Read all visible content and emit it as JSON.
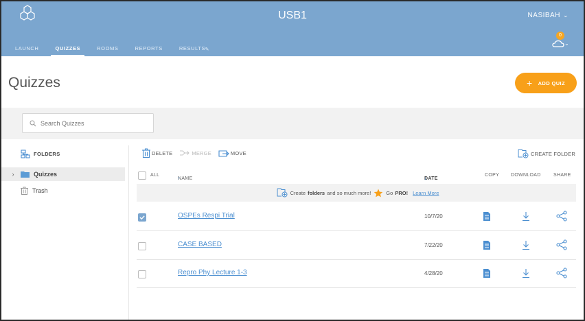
{
  "header": {
    "app_title": "USB1",
    "user_name": "NASIBAH",
    "notification_count": "0",
    "tabs": [
      {
        "label": "LAUNCH"
      },
      {
        "label": "QUIZZES"
      },
      {
        "label": "ROOMS"
      },
      {
        "label": "REPORTS"
      },
      {
        "label": "RESULTS"
      }
    ]
  },
  "page": {
    "title": "Quizzes",
    "add_button_label": "ADD QUIZ"
  },
  "search": {
    "placeholder": "Search Quizzes"
  },
  "folders": {
    "heading": "FOLDERS",
    "items": [
      {
        "label": "Quizzes"
      },
      {
        "label": "Trash"
      }
    ]
  },
  "toolbar": {
    "delete_label": "DELETE",
    "merge_label": "MERGE",
    "move_label": "MOVE",
    "create_folder_label": "CREATE FOLDER"
  },
  "table": {
    "headers": {
      "all": "ALL",
      "name": "NAME",
      "name_sort": "↑",
      "date": "DATE",
      "date_sort": "↓",
      "copy": "COPY",
      "download": "DOWNLOAD",
      "share": "SHARE"
    },
    "promo": {
      "text_before": "Create",
      "bold": "folders",
      "text_after": "and so much more!",
      "go_pro": "Go",
      "pro": "PRO!",
      "link": "Learn More"
    },
    "rows": [
      {
        "name": "OSPEs Respi Trial",
        "date": "10/7/20",
        "checked": true
      },
      {
        "name": "CASE BASED",
        "date": "7/22/20",
        "checked": false
      },
      {
        "name": "Repro Phy Lecture 1-3",
        "date": "4/28/20",
        "checked": false
      }
    ]
  },
  "colors": {
    "header_bg": "#7ba6cf",
    "accent_orange": "#f8a019",
    "link_blue": "#4a8ed0"
  }
}
